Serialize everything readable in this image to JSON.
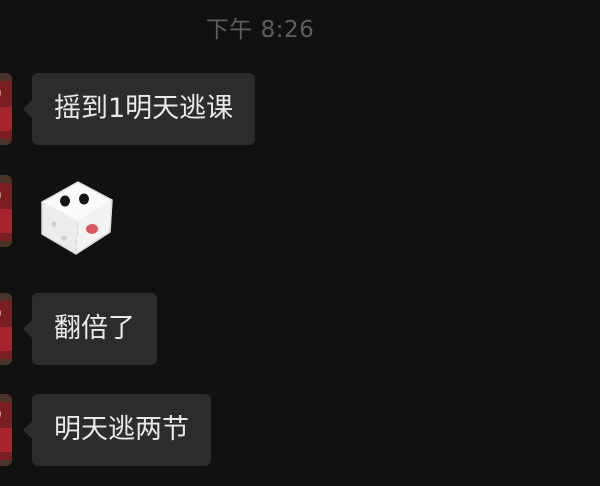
{
  "chat": {
    "timestamp": "下午 8:26",
    "messages": [
      {
        "type": "text",
        "text": "摇到1明天逃课"
      },
      {
        "type": "dice",
        "icon": "dice-icon",
        "face_up": 2
      },
      {
        "type": "text",
        "text": "翻倍了"
      },
      {
        "type": "text",
        "text": "明天逃两节"
      }
    ]
  },
  "colors": {
    "background": "#111111",
    "bubble": "#2c2c2c",
    "text": "#e9e9e9",
    "timestamp": "#5e5e5e"
  }
}
